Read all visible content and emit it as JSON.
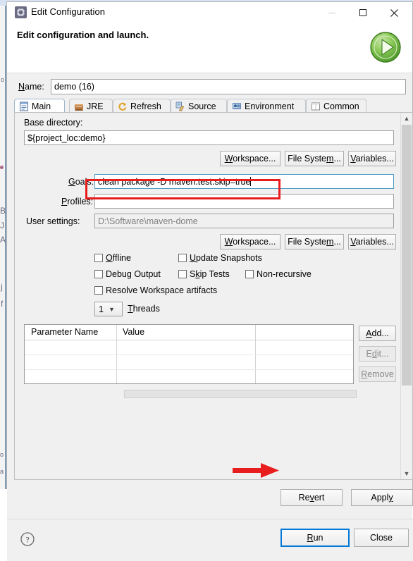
{
  "window": {
    "title": "Edit Configuration",
    "icon": "gear-icon",
    "minimize_label": "—",
    "maximize_label": "□",
    "close_label": "✕"
  },
  "header": {
    "title": "Edit configuration and launch.",
    "run_icon": "green-run-icon"
  },
  "name_row": {
    "label": "Name:",
    "label_mnemonic": "N",
    "value": "demo (16)"
  },
  "tabs": [
    {
      "label": "Main",
      "icon": "main-tab-icon",
      "active": true
    },
    {
      "label": "JRE",
      "icon": "jre-tab-icon",
      "active": false
    },
    {
      "label": "Refresh",
      "icon": "refresh-tab-icon",
      "active": false
    },
    {
      "label": "Source",
      "icon": "source-tab-icon",
      "active": false
    },
    {
      "label": "Environment",
      "icon": "environment-tab-icon",
      "active": false
    },
    {
      "label": "Common",
      "icon": "common-tab-icon",
      "active": false
    }
  ],
  "main_tab": {
    "base_directory": {
      "label": "Base directory:",
      "value": "${project_loc:demo}"
    },
    "base_buttons": [
      {
        "label": "Workspace...",
        "name": "base-workspace-button"
      },
      {
        "label": "File System...",
        "name": "base-filesystem-button"
      },
      {
        "label": "Variables...",
        "name": "base-variables-button"
      }
    ],
    "goals": {
      "label": "Goals:",
      "value": "clean package -D maven.test.skip=true"
    },
    "profiles": {
      "label": "Profiles:",
      "value": ""
    },
    "user_settings": {
      "label": "User settings:",
      "value": "D:\\Software\\maven-dome"
    },
    "user_buttons": [
      {
        "label": "Workspace...",
        "name": "settings-workspace-button"
      },
      {
        "label": "File System...",
        "name": "settings-filesystem-button"
      },
      {
        "label": "Variables...",
        "name": "settings-variables-button"
      }
    ],
    "checkboxes": [
      {
        "label": "Offline",
        "checked": false,
        "name": "offline-checkbox"
      },
      {
        "label": "Update Snapshots",
        "checked": false,
        "name": "update-snapshots-checkbox"
      },
      {
        "label": "Debug Output",
        "checked": false,
        "name": "debug-output-checkbox"
      },
      {
        "label": "Skip Tests",
        "checked": false,
        "name": "skip-tests-checkbox"
      },
      {
        "label": "Non-recursive",
        "checked": false,
        "name": "non-recursive-checkbox"
      },
      {
        "label": "Resolve Workspace artifacts",
        "checked": false,
        "name": "resolve-workspace-artifacts-checkbox"
      }
    ],
    "threads": {
      "value": "1",
      "label": "Threads"
    },
    "parameter_table": {
      "columns": [
        "Parameter Name",
        "Value"
      ],
      "rows": []
    },
    "table_buttons": [
      {
        "label": "Add...",
        "enabled": true,
        "name": "add-parameter-button"
      },
      {
        "label": "Edit...",
        "enabled": false,
        "name": "edit-parameter-button"
      },
      {
        "label": "Remove",
        "enabled": false,
        "name": "remove-parameter-button"
      }
    ]
  },
  "apply_bar": {
    "revert_label": "Revert",
    "apply_label": "Apply"
  },
  "bottom_bar": {
    "help_icon": "help-icon",
    "run_label": "Run",
    "close_label": "Close"
  },
  "annotations": {
    "goals_highlight_color": "#e81d1d",
    "run_arrow_color": "#e81d1d"
  },
  "background": {
    "ghost_fragments": [
      "e",
      "B",
      "J",
      "A",
      "j",
      "f",
      "o",
      "a"
    ]
  },
  "colors": {
    "accent_focus": "#0078d7",
    "dialog_bg": "#f0f0f0",
    "field_bg": "#ffffff",
    "annotation_red": "#e81d1d",
    "run_green": "#66bb3f"
  }
}
